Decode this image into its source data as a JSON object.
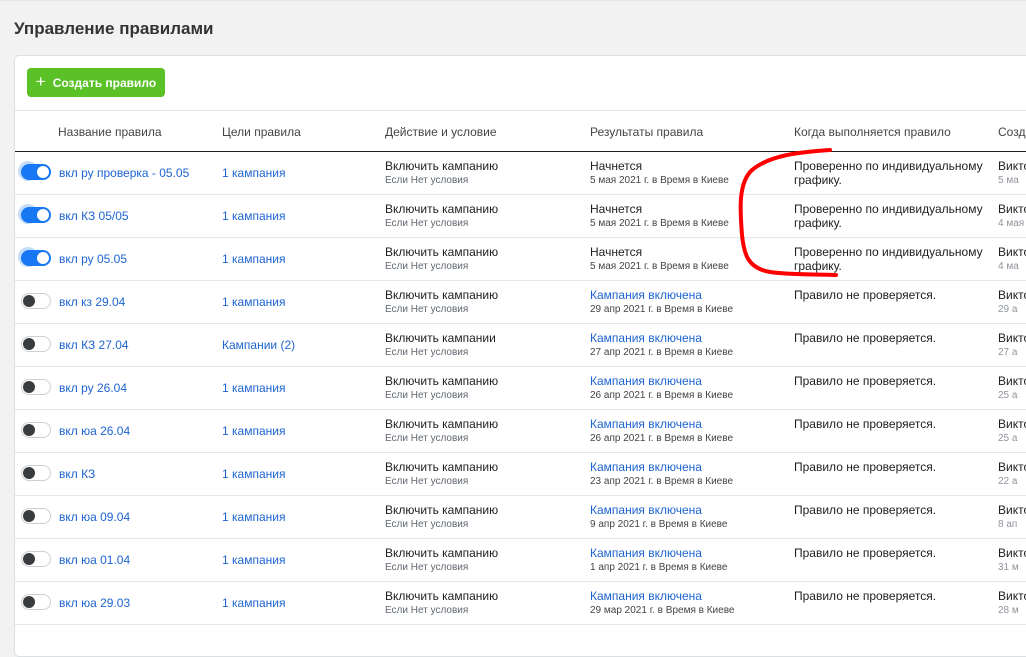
{
  "page_title": "Управление правилами",
  "create_button": "Создать правило",
  "columns": [
    "Название правила",
    "Цели правила",
    "Действие и условие",
    "Результаты правила",
    "Когда выполняется правило",
    "Созда"
  ],
  "rows": [
    {
      "on": true,
      "name": "вкл ру проверка - 05.05",
      "target": "1 кампания",
      "action": "Включить кампанию",
      "condition": "Если Нет условия",
      "result": "Начнется",
      "result_is_link": false,
      "result_date": "5 мая 2021 г. в Время в Киеве",
      "when": "Проверенно по индивидуальному графику.",
      "creator": "Викто",
      "created": "5 ма"
    },
    {
      "on": true,
      "name": "вкл КЗ 05/05",
      "target": "1 кампания",
      "action": "Включить кампанию",
      "condition": "Если Нет условия",
      "result": "Начнется",
      "result_is_link": false,
      "result_date": "5 мая 2021 г. в Время в Киеве",
      "when": "Проверенно по индивидуальному графику.",
      "creator": "Викто",
      "created": "4 мая"
    },
    {
      "on": true,
      "name": "вкл ру 05.05",
      "target": "1 кампания",
      "action": "Включить кампанию",
      "condition": "Если Нет условия",
      "result": "Начнется",
      "result_is_link": false,
      "result_date": "5 мая 2021 г. в Время в Киеве",
      "when": "Проверенно по индивидуальному графику.",
      "creator": "Викто",
      "created": "4 ма"
    },
    {
      "on": false,
      "name": "вкл кз 29.04",
      "target": "1 кампания",
      "action": "Включить кампанию",
      "condition": "Если Нет условия",
      "result": "Кампания включена",
      "result_is_link": true,
      "result_date": "29 апр 2021 г. в Время в Киеве",
      "when": "Правило не проверяется.",
      "creator": "Викто",
      "created": "29 а"
    },
    {
      "on": false,
      "name": "вкл КЗ 27.04",
      "target": "Кампании (2)",
      "action": "Включить кампании",
      "condition": "Если Нет условия",
      "result": "Кампания включена",
      "result_is_link": true,
      "result_date": "27 апр 2021 г. в Время в Киеве",
      "when": "Правило не проверяется.",
      "creator": "Викто",
      "created": "27 а"
    },
    {
      "on": false,
      "name": "вкл ру 26.04",
      "target": "1 кампания",
      "action": "Включить кампанию",
      "condition": "Если Нет условия",
      "result": "Кампания включена",
      "result_is_link": true,
      "result_date": "26 апр 2021 г. в Время в Киеве",
      "when": "Правило не проверяется.",
      "creator": "Викто",
      "created": "25 а"
    },
    {
      "on": false,
      "name": "вкл юа 26.04",
      "target": "1 кампания",
      "action": "Включить кампанию",
      "condition": "Если Нет условия",
      "result": "Кампания включена",
      "result_is_link": true,
      "result_date": "26 апр 2021 г. в Время в Киеве",
      "when": "Правило не проверяется.",
      "creator": "Викто",
      "created": "25 а"
    },
    {
      "on": false,
      "name": "вкл КЗ",
      "target": "1 кампания",
      "action": "Включить кампанию",
      "condition": "Если Нет условия",
      "result": "Кампания включена",
      "result_is_link": true,
      "result_date": "23 апр 2021 г. в Время в Киеве",
      "when": "Правило не проверяется.",
      "creator": "Викто",
      "created": "22 а"
    },
    {
      "on": false,
      "name": "вкл юа 09.04",
      "target": "1 кампания",
      "action": "Включить кампанию",
      "condition": "Если Нет условия",
      "result": "Кампания включена",
      "result_is_link": true,
      "result_date": "9 апр 2021 г. в Время в Киеве",
      "when": "Правило не проверяется.",
      "creator": "Викто",
      "created": "8 ап"
    },
    {
      "on": false,
      "name": "вкл юа 01.04",
      "target": "1 кампания",
      "action": "Включить кампанию",
      "condition": "Если Нет условия",
      "result": "Кампания включена",
      "result_is_link": true,
      "result_date": "1 апр 2021 г. в Время в Киеве",
      "when": "Правило не проверяется.",
      "creator": "Викто",
      "created": "31 м"
    },
    {
      "on": false,
      "name": "вкл юа 29.03",
      "target": "1 кампания",
      "action": "Включить кампанию",
      "condition": "Если Нет условия",
      "result": "Кампания включена",
      "result_is_link": true,
      "result_date": "29 мар 2021 г. в Время в Киеве",
      "when": "Правило не проверяется.",
      "creator": "Викто",
      "created": "28 м"
    }
  ],
  "colors": {
    "accent": "#1877f2",
    "create": "#5ac127",
    "link": "#1d64d2",
    "annotation": "#ff0000"
  }
}
